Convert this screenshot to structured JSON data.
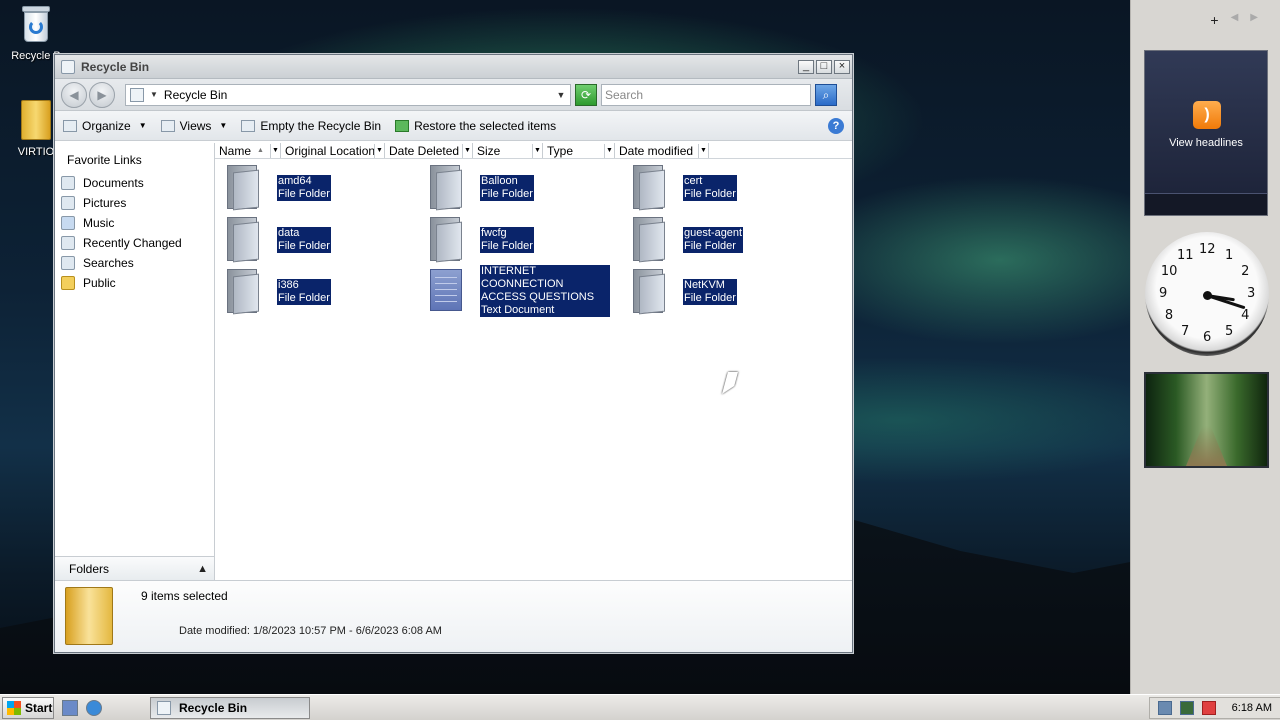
{
  "desktop": {
    "icons": [
      {
        "label": "Recycle B"
      },
      {
        "label": "VIRTIO"
      }
    ]
  },
  "window": {
    "title": "Recycle Bin",
    "address": {
      "crumb": "Recycle Bin"
    },
    "search_placeholder": "Search",
    "toolbar": {
      "organize": "Organize",
      "views": "Views",
      "empty": "Empty the Recycle Bin",
      "restore": "Restore the selected items"
    },
    "nav": {
      "heading": "Favorite Links",
      "items": [
        "Documents",
        "Pictures",
        "Music",
        "Recently Changed",
        "Searches",
        "Public"
      ],
      "folders_label": "Folders"
    },
    "columns": [
      "Name",
      "Original Location",
      "Date Deleted",
      "Size",
      "Type",
      "Date modified"
    ],
    "items": [
      {
        "name": "amd64",
        "type": "File Folder"
      },
      {
        "name": "Balloon",
        "type": "File Folder"
      },
      {
        "name": "cert",
        "type": "File Folder"
      },
      {
        "name": "data",
        "type": "File Folder"
      },
      {
        "name": "fwcfg",
        "type": "File Folder"
      },
      {
        "name": "guest-agent",
        "type": "File Folder"
      },
      {
        "name": "i386",
        "type": "File Folder"
      },
      {
        "name": "INTERNET COONNECTION ACCESS QUESTIONS",
        "type": "Text Document"
      },
      {
        "name": "NetKVM",
        "type": "File Folder"
      }
    ],
    "details": {
      "count": "9 items selected",
      "date_modified": "Date modified:  1/8/2023 10:57 PM - 6/6/2023 6:08 AM"
    }
  },
  "sidebar": {
    "feed_label": "View headlines",
    "clock": {
      "hour": 3,
      "minute": 18
    }
  },
  "taskbar": {
    "start": "Start",
    "task": "Recycle Bin",
    "time": "6:18 AM"
  }
}
